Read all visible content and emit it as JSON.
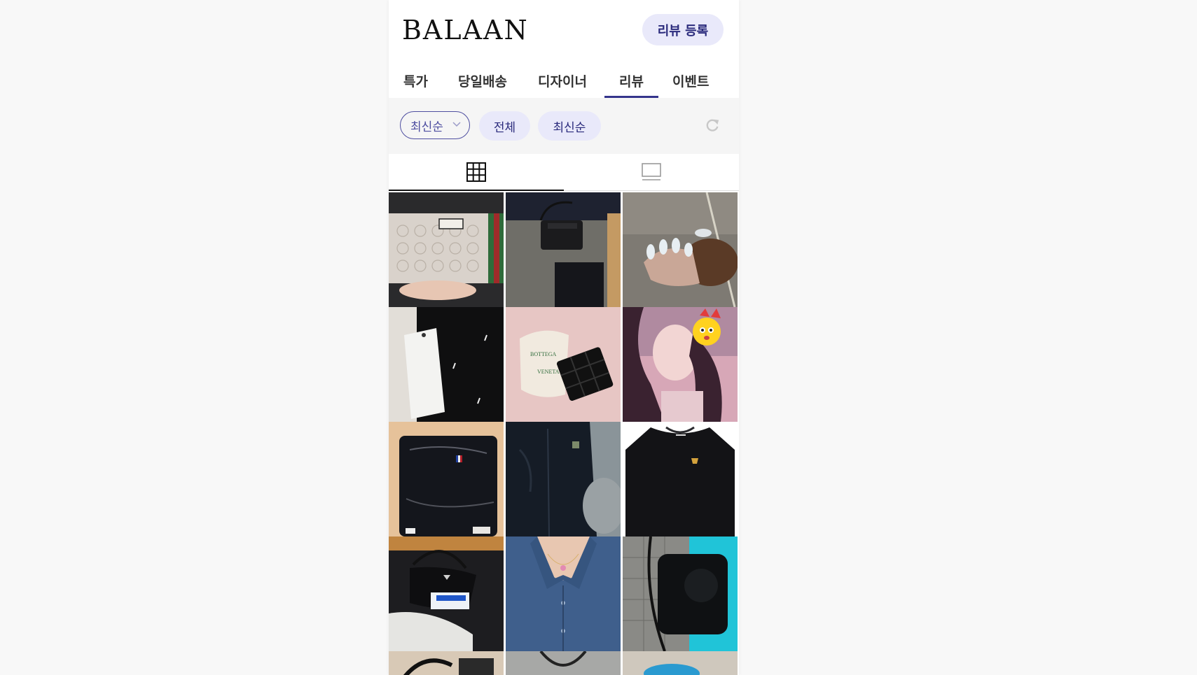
{
  "header": {
    "logo": "BALAAN",
    "review_button": "리뷰 등록"
  },
  "nav": {
    "tabs": [
      {
        "label": "특가"
      },
      {
        "label": "당일배송"
      },
      {
        "label": "디자이너"
      },
      {
        "label": "리뷰",
        "active": true
      },
      {
        "label": "이벤트"
      }
    ],
    "accent": "#34348c"
  },
  "filters": {
    "sort_select": "최신순",
    "chips": [
      "전체",
      "최신순"
    ],
    "refresh_icon": "refresh-icon"
  },
  "view_toggle": {
    "options": [
      {
        "icon": "grid-icon",
        "active": true
      },
      {
        "icon": "list-icon",
        "active": false
      }
    ]
  },
  "photos": [
    {
      "icon": "photo-gucci-pouch"
    },
    {
      "icon": "photo-black-crossbody-bag"
    },
    {
      "icon": "photo-manicure"
    },
    {
      "icon": "photo-black-knit-with-tag"
    },
    {
      "icon": "photo-bottega-veneta-wallet"
    },
    {
      "icon": "photo-selfie-with-sticker"
    },
    {
      "icon": "photo-packaged-cardigan"
    },
    {
      "icon": "photo-navy-padded-jacket"
    },
    {
      "icon": "photo-black-sweater"
    },
    {
      "icon": "photo-prada-nylon-bag"
    },
    {
      "icon": "photo-denim-shirt-necklace"
    },
    {
      "icon": "photo-black-camera-bag"
    },
    {
      "icon": "photo-partial-1"
    },
    {
      "icon": "photo-partial-2"
    },
    {
      "icon": "photo-partial-3"
    }
  ]
}
